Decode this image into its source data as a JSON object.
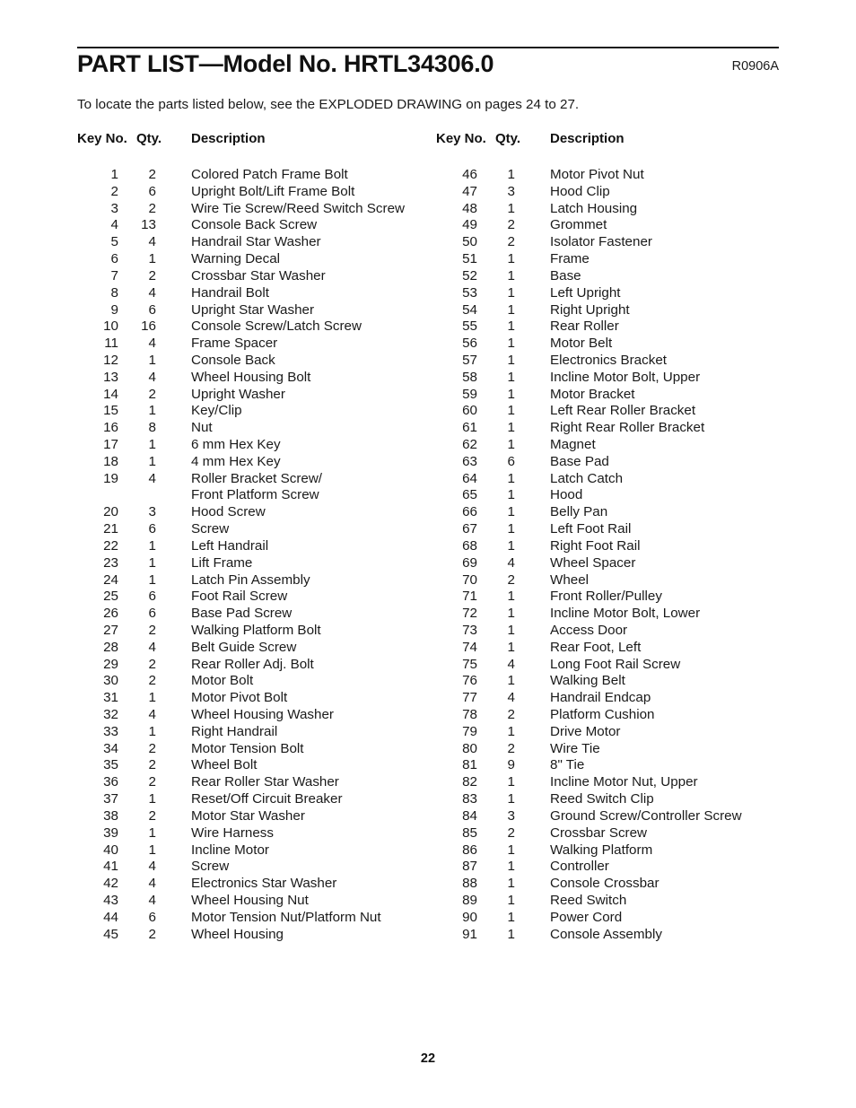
{
  "document": {
    "title": "PART LIST—Model No. HRTL34306.0",
    "revision_code": "R0906A",
    "subtitle": "To locate the parts listed below, see the EXPLODED DRAWING on pages 24 to 27.",
    "page_number": "22"
  },
  "table": {
    "headers": {
      "key_no": "Key No.",
      "qty": "Qty.",
      "description": "Description"
    },
    "left_column": [
      {
        "key": "1",
        "qty": "2",
        "desc": "Colored Patch Frame Bolt"
      },
      {
        "key": "2",
        "qty": "6",
        "desc": "Upright Bolt/Lift Frame Bolt"
      },
      {
        "key": "3",
        "qty": "2",
        "desc": "Wire Tie Screw/Reed Switch Screw"
      },
      {
        "key": "4",
        "qty": "13",
        "desc": "Console Back Screw"
      },
      {
        "key": "5",
        "qty": "4",
        "desc": "Handrail Star Washer"
      },
      {
        "key": "6",
        "qty": "1",
        "desc": "Warning Decal"
      },
      {
        "key": "7",
        "qty": "2",
        "desc": "Crossbar Star Washer"
      },
      {
        "key": "8",
        "qty": "4",
        "desc": "Handrail Bolt"
      },
      {
        "key": "9",
        "qty": "6",
        "desc": "Upright Star Washer"
      },
      {
        "key": "10",
        "qty": "16",
        "desc": "Console Screw/Latch Screw"
      },
      {
        "key": "11",
        "qty": "4",
        "desc": "Frame Spacer"
      },
      {
        "key": "12",
        "qty": "1",
        "desc": "Console Back"
      },
      {
        "key": "13",
        "qty": "4",
        "desc": "Wheel Housing Bolt"
      },
      {
        "key": "14",
        "qty": "2",
        "desc": "Upright Washer"
      },
      {
        "key": "15",
        "qty": "1",
        "desc": "Key/Clip"
      },
      {
        "key": "16",
        "qty": "8",
        "desc": "Nut"
      },
      {
        "key": "17",
        "qty": "1",
        "desc": "6 mm Hex Key"
      },
      {
        "key": "18",
        "qty": "1",
        "desc": "4 mm Hex Key"
      },
      {
        "key": "19",
        "qty": "4",
        "desc": "Roller Bracket Screw/"
      },
      {
        "key": "",
        "qty": "",
        "desc": "Front Platform Screw"
      },
      {
        "key": "20",
        "qty": "3",
        "desc": "Hood Screw"
      },
      {
        "key": "21",
        "qty": "6",
        "desc": "Screw"
      },
      {
        "key": "22",
        "qty": "1",
        "desc": "Left Handrail"
      },
      {
        "key": "23",
        "qty": "1",
        "desc": "Lift Frame"
      },
      {
        "key": "24",
        "qty": "1",
        "desc": "Latch Pin Assembly"
      },
      {
        "key": "25",
        "qty": "6",
        "desc": "Foot Rail Screw"
      },
      {
        "key": "26",
        "qty": "6",
        "desc": "Base Pad Screw"
      },
      {
        "key": "27",
        "qty": "2",
        "desc": "Walking Platform Bolt"
      },
      {
        "key": "28",
        "qty": "4",
        "desc": "Belt Guide Screw"
      },
      {
        "key": "29",
        "qty": "2",
        "desc": "Rear Roller Adj. Bolt"
      },
      {
        "key": "30",
        "qty": "2",
        "desc": "Motor Bolt"
      },
      {
        "key": "31",
        "qty": "1",
        "desc": "Motor Pivot Bolt"
      },
      {
        "key": "32",
        "qty": "4",
        "desc": "Wheel Housing Washer"
      },
      {
        "key": "33",
        "qty": "1",
        "desc": "Right Handrail"
      },
      {
        "key": "34",
        "qty": "2",
        "desc": "Motor Tension Bolt"
      },
      {
        "key": "35",
        "qty": "2",
        "desc": "Wheel Bolt"
      },
      {
        "key": "36",
        "qty": "2",
        "desc": "Rear Roller Star Washer"
      },
      {
        "key": "37",
        "qty": "1",
        "desc": "Reset/Off Circuit Breaker"
      },
      {
        "key": "38",
        "qty": "2",
        "desc": "Motor Star Washer"
      },
      {
        "key": "39",
        "qty": "1",
        "desc": "Wire Harness"
      },
      {
        "key": "40",
        "qty": "1",
        "desc": "Incline Motor"
      },
      {
        "key": "41",
        "qty": "4",
        "desc": "Screw"
      },
      {
        "key": "42",
        "qty": "4",
        "desc": "Electronics Star Washer"
      },
      {
        "key": "43",
        "qty": "4",
        "desc": "Wheel Housing Nut"
      },
      {
        "key": "44",
        "qty": "6",
        "desc": "Motor Tension Nut/Platform Nut"
      },
      {
        "key": "45",
        "qty": "2",
        "desc": "Wheel Housing"
      }
    ],
    "right_column": [
      {
        "key": "46",
        "qty": "1",
        "desc": "Motor Pivot Nut"
      },
      {
        "key": "47",
        "qty": "3",
        "desc": "Hood Clip"
      },
      {
        "key": "48",
        "qty": "1",
        "desc": "Latch Housing"
      },
      {
        "key": "49",
        "qty": "2",
        "desc": "Grommet"
      },
      {
        "key": "50",
        "qty": "2",
        "desc": "Isolator Fastener"
      },
      {
        "key": "51",
        "qty": "1",
        "desc": "Frame"
      },
      {
        "key": "52",
        "qty": "1",
        "desc": "Base"
      },
      {
        "key": "53",
        "qty": "1",
        "desc": "Left Upright"
      },
      {
        "key": "54",
        "qty": "1",
        "desc": "Right Upright"
      },
      {
        "key": "55",
        "qty": "1",
        "desc": "Rear Roller"
      },
      {
        "key": "56",
        "qty": "1",
        "desc": "Motor Belt"
      },
      {
        "key": "57",
        "qty": "1",
        "desc": "Electronics Bracket"
      },
      {
        "key": "58",
        "qty": "1",
        "desc": "Incline Motor Bolt, Upper"
      },
      {
        "key": "59",
        "qty": "1",
        "desc": "Motor Bracket"
      },
      {
        "key": "60",
        "qty": "1",
        "desc": "Left Rear Roller Bracket"
      },
      {
        "key": "61",
        "qty": "1",
        "desc": "Right Rear Roller Bracket"
      },
      {
        "key": "62",
        "qty": "1",
        "desc": "Magnet"
      },
      {
        "key": "63",
        "qty": "6",
        "desc": "Base Pad"
      },
      {
        "key": "64",
        "qty": "1",
        "desc": "Latch Catch"
      },
      {
        "key": "65",
        "qty": "1",
        "desc": "Hood"
      },
      {
        "key": "66",
        "qty": "1",
        "desc": "Belly Pan"
      },
      {
        "key": "67",
        "qty": "1",
        "desc": "Left Foot Rail"
      },
      {
        "key": "68",
        "qty": "1",
        "desc": "Right Foot Rail"
      },
      {
        "key": "69",
        "qty": "4",
        "desc": "Wheel Spacer"
      },
      {
        "key": "70",
        "qty": "2",
        "desc": "Wheel"
      },
      {
        "key": "71",
        "qty": "1",
        "desc": "Front Roller/Pulley"
      },
      {
        "key": "72",
        "qty": "1",
        "desc": "Incline Motor Bolt, Lower"
      },
      {
        "key": "73",
        "qty": "1",
        "desc": "Access Door"
      },
      {
        "key": "74",
        "qty": "1",
        "desc": "Rear Foot, Left"
      },
      {
        "key": "75",
        "qty": "4",
        "desc": "Long Foot Rail Screw"
      },
      {
        "key": "76",
        "qty": "1",
        "desc": "Walking Belt"
      },
      {
        "key": "77",
        "qty": "4",
        "desc": "Handrail Endcap"
      },
      {
        "key": "78",
        "qty": "2",
        "desc": "Platform Cushion"
      },
      {
        "key": "79",
        "qty": "1",
        "desc": "Drive Motor"
      },
      {
        "key": "80",
        "qty": "2",
        "desc": "Wire Tie"
      },
      {
        "key": "81",
        "qty": "9",
        "desc": "8\" Tie"
      },
      {
        "key": "82",
        "qty": "1",
        "desc": "Incline Motor Nut, Upper"
      },
      {
        "key": "83",
        "qty": "1",
        "desc": "Reed Switch Clip"
      },
      {
        "key": "84",
        "qty": "3",
        "desc": "Ground Screw/Controller Screw"
      },
      {
        "key": "85",
        "qty": "2",
        "desc": "Crossbar Screw"
      },
      {
        "key": "86",
        "qty": "1",
        "desc": "Walking Platform"
      },
      {
        "key": "87",
        "qty": "1",
        "desc": "Controller"
      },
      {
        "key": "88",
        "qty": "1",
        "desc": "Console Crossbar"
      },
      {
        "key": "89",
        "qty": "1",
        "desc": "Reed Switch"
      },
      {
        "key": "90",
        "qty": "1",
        "desc": "Power Cord"
      },
      {
        "key": "91",
        "qty": "1",
        "desc": "Console Assembly"
      }
    ]
  }
}
